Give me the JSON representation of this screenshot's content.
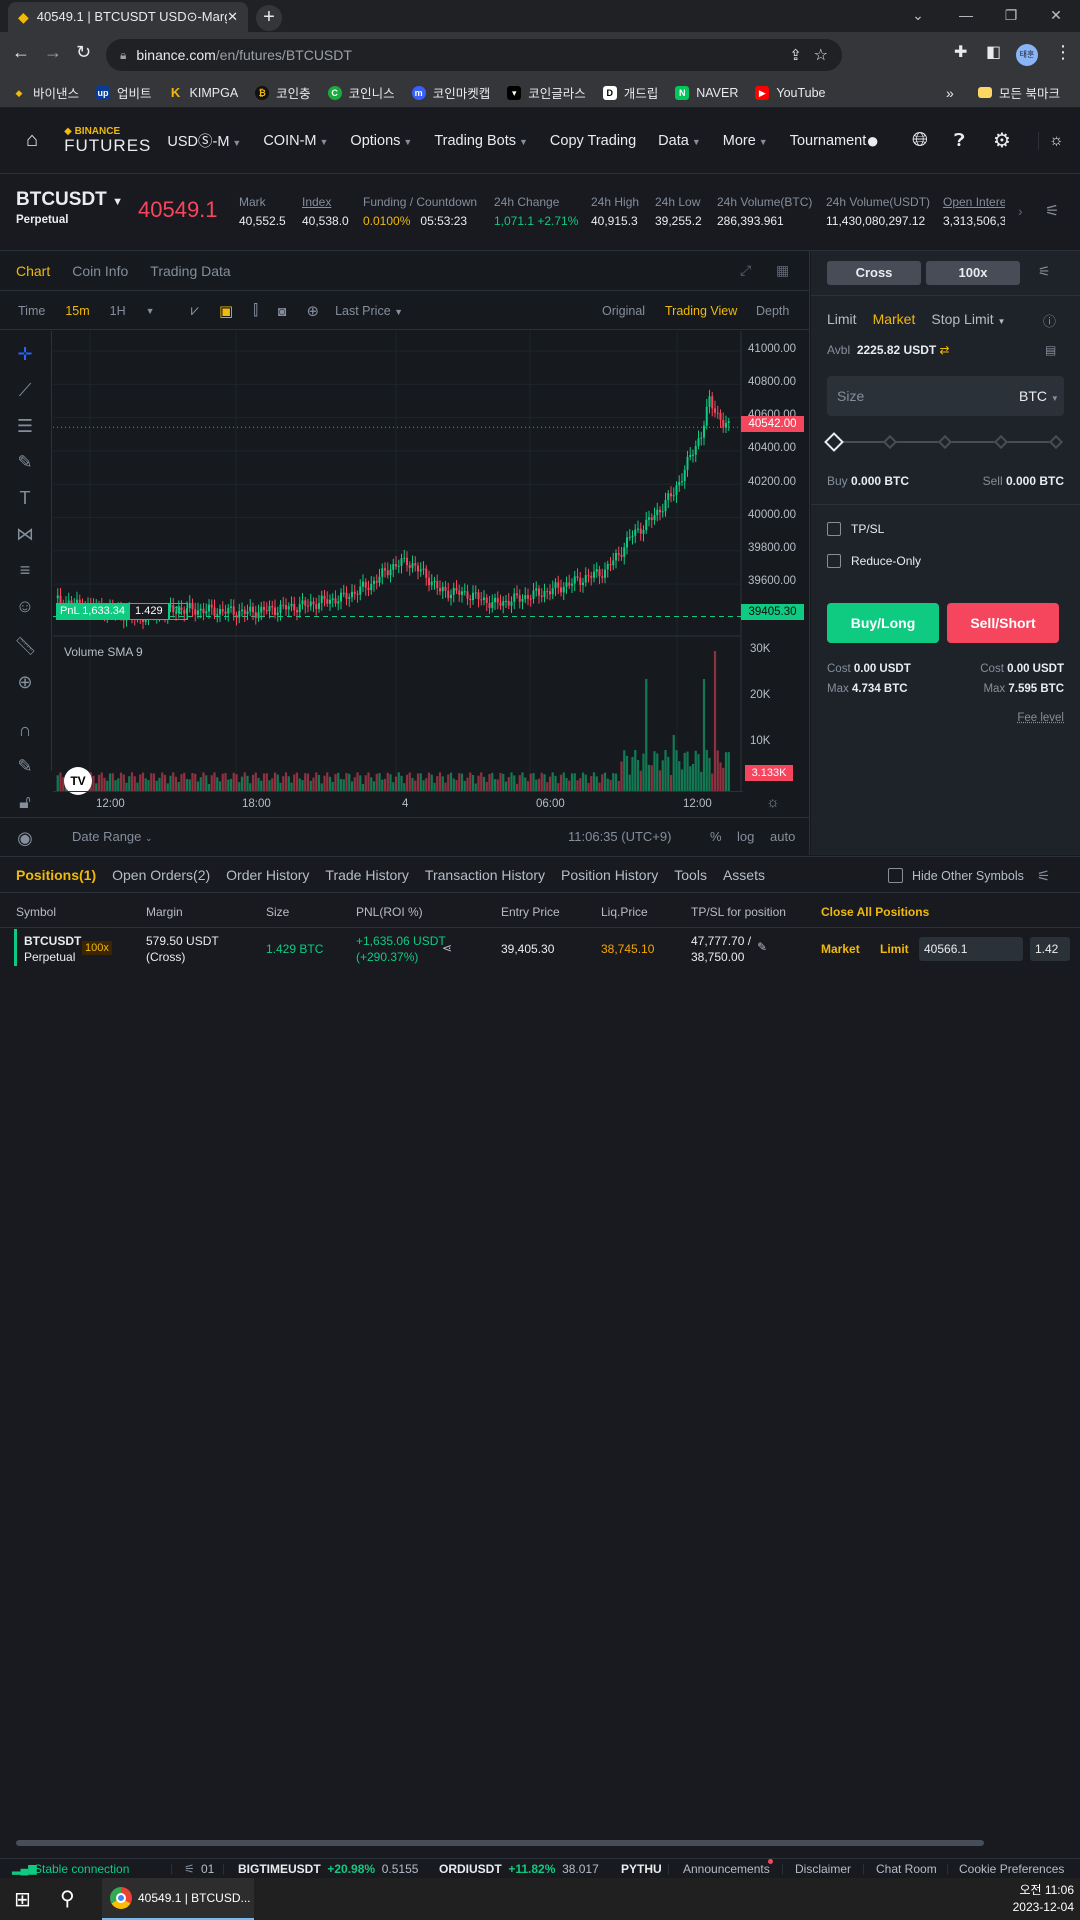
{
  "browser": {
    "tab_title": "40549.1 | BTCUSDT USD⊙-Marg",
    "url_host": "binance.com",
    "url_path": "/en/futures/BTCUSDT",
    "profile": "태훈",
    "bookmarks": [
      {
        "label": "바이낸스",
        "icon": "binance-icon",
        "color": "#f0b90b"
      },
      {
        "label": "업비트",
        "icon": "upbit-icon",
        "color": "#0a3c96"
      },
      {
        "label": "KIMPGA",
        "icon": "kimpga-icon",
        "color": "#f0b90b"
      },
      {
        "label": "코인충",
        "icon": "coinchung-icon",
        "color": "#333"
      },
      {
        "label": "코인니스",
        "icon": "coinness-icon",
        "color": "#1aab3c"
      },
      {
        "label": "코인마켓캡",
        "icon": "coinmarketcap-icon",
        "color": "#3861fb"
      },
      {
        "label": "코인글라스",
        "icon": "coinglass-icon",
        "color": "#000"
      },
      {
        "label": "개드립",
        "icon": "gaedrip-icon",
        "color": "#fff"
      },
      {
        "label": "NAVER",
        "icon": "naver-icon",
        "color": "#03c75a"
      },
      {
        "label": "YouTube",
        "icon": "youtube-icon",
        "color": "#ff0000"
      }
    ],
    "all_bookmarks": "모든 북마크"
  },
  "header": {
    "logo_top": "BINANCE",
    "logo_bottom": "FUTURES",
    "nav": [
      "USDⓈ-M",
      "COIN-M",
      "Options",
      "Trading Bots",
      "Copy Trading",
      "Data",
      "More",
      "Tournament"
    ]
  },
  "ticker": {
    "symbol": "BTCUSDT",
    "sub": "Perpetual",
    "last_price": "40549.1",
    "stats": [
      {
        "label": "Mark",
        "value": "40,552.5"
      },
      {
        "label": "Index",
        "value": "40,538.0"
      },
      {
        "label": "Funding / Countdown",
        "value": "0.0100%",
        "value2": "05:53:23"
      },
      {
        "label": "24h Change",
        "value": "1,071.1 +2.71%"
      },
      {
        "label": "24h High",
        "value": "40,915.3"
      },
      {
        "label": "24h Low",
        "value": "39,255.2"
      },
      {
        "label": "24h Volume(BTC)",
        "value": "286,393.961"
      },
      {
        "label": "24h Volume(USDT)",
        "value": "11,430,080,297.12"
      },
      {
        "label": "Open Intere",
        "value": "3,313,506,3"
      }
    ]
  },
  "chart_panel": {
    "tabs": [
      "Chart",
      "Coin Info",
      "Trading Data"
    ],
    "toolbar": {
      "time": "Time",
      "int1": "15m",
      "int2": "1H",
      "price_type": "Last Price",
      "view_original": "Original",
      "view_tv": "Trading View",
      "view_depth": "Depth"
    },
    "y_ticks": [
      "41000.00",
      "40800.00",
      "40600.00",
      "40400.00",
      "40200.00",
      "40000.00",
      "39800.00",
      "39600.00"
    ],
    "current_price_tag": "40542.00",
    "entry_price_tag": "39405.30",
    "pnl_label": "PnL 1,633.34",
    "pnl_qty": "1.429",
    "volume_label": "Volume SMA 9",
    "vol_ticks": [
      "30K",
      "20K",
      "10K"
    ],
    "vol_tag": "3.133K",
    "x_ticks": [
      "12:00",
      "18:00",
      "4",
      "06:00",
      "12:00"
    ],
    "date_range": "Date Range",
    "clock": "11:06:35 (UTC+9)",
    "opt_pct": "%",
    "opt_log": "log",
    "opt_auto": "auto"
  },
  "order_panel": {
    "margin_mode": "Cross",
    "leverage": "100x",
    "types": [
      "Limit",
      "Market",
      "Stop Limit"
    ],
    "avbl_label": "Avbl",
    "avbl_value": "2225.82 USDT",
    "size_placeholder": "Size",
    "size_unit": "BTC",
    "buy_label": "Buy",
    "buy_value": "0.000 BTC",
    "sell_label": "Sell",
    "sell_value": "0.000 BTC",
    "tpsl": "TP/SL",
    "reduce_only": "Reduce-Only",
    "buy_btn": "Buy/Long",
    "sell_btn": "Sell/Short",
    "cost_label": "Cost",
    "cost_buy": "0.00 USDT",
    "cost_sell": "0.00 USDT",
    "max_label": "Max",
    "max_buy": "4.734 BTC",
    "max_sell": "7.595 BTC",
    "fee_level": "Fee level"
  },
  "positions": {
    "tabs": [
      "Positions(1)",
      "Open Orders(2)",
      "Order History",
      "Trade History",
      "Transaction History",
      "Position History",
      "Tools",
      "Assets"
    ],
    "hide_other": "Hide Other Symbols",
    "headers": [
      "Symbol",
      "Margin",
      "Size",
      "PNL(ROI %)",
      "Entry Price",
      "Liq.Price",
      "TP/SL for position",
      "Close All Positions"
    ],
    "row": {
      "symbol": "BTCUSDT",
      "sub": "Perpetual",
      "lev": "100x",
      "margin": "579.50 USDT",
      "margin_mode": "(Cross)",
      "size": "1.429 BTC",
      "pnl": "+1,635.06 USDT",
      "roi": "(+290.37%)",
      "entry": "39,405.30",
      "liq": "38,745.10",
      "tp": "47,777.70 /",
      "sl": "38,750.00",
      "market": "Market",
      "limit": "Limit",
      "limit_value": "40566.1",
      "extra": "1.42"
    }
  },
  "status_bar": {
    "connection": "Stable connection",
    "count": "01",
    "t1_sym": "BIGTIMEUSDT",
    "t1_chg": "+20.98%",
    "t1_px": "0.5155",
    "t2_sym": "ORDIUSDT",
    "t2_chg": "+11.82%",
    "t2_px": "38.017",
    "t3_sym": "PYTHU",
    "links": [
      "Announcements",
      "Disclaimer",
      "Chat Room",
      "Cookie Preferences"
    ]
  },
  "taskbar": {
    "app_title": "40549.1 | BTCUSD...",
    "time": "오전 11:06",
    "date": "2023-12-04"
  },
  "colors": {
    "accent": "#f0b90b",
    "up": "#0ecb81",
    "down": "#f6465d"
  }
}
